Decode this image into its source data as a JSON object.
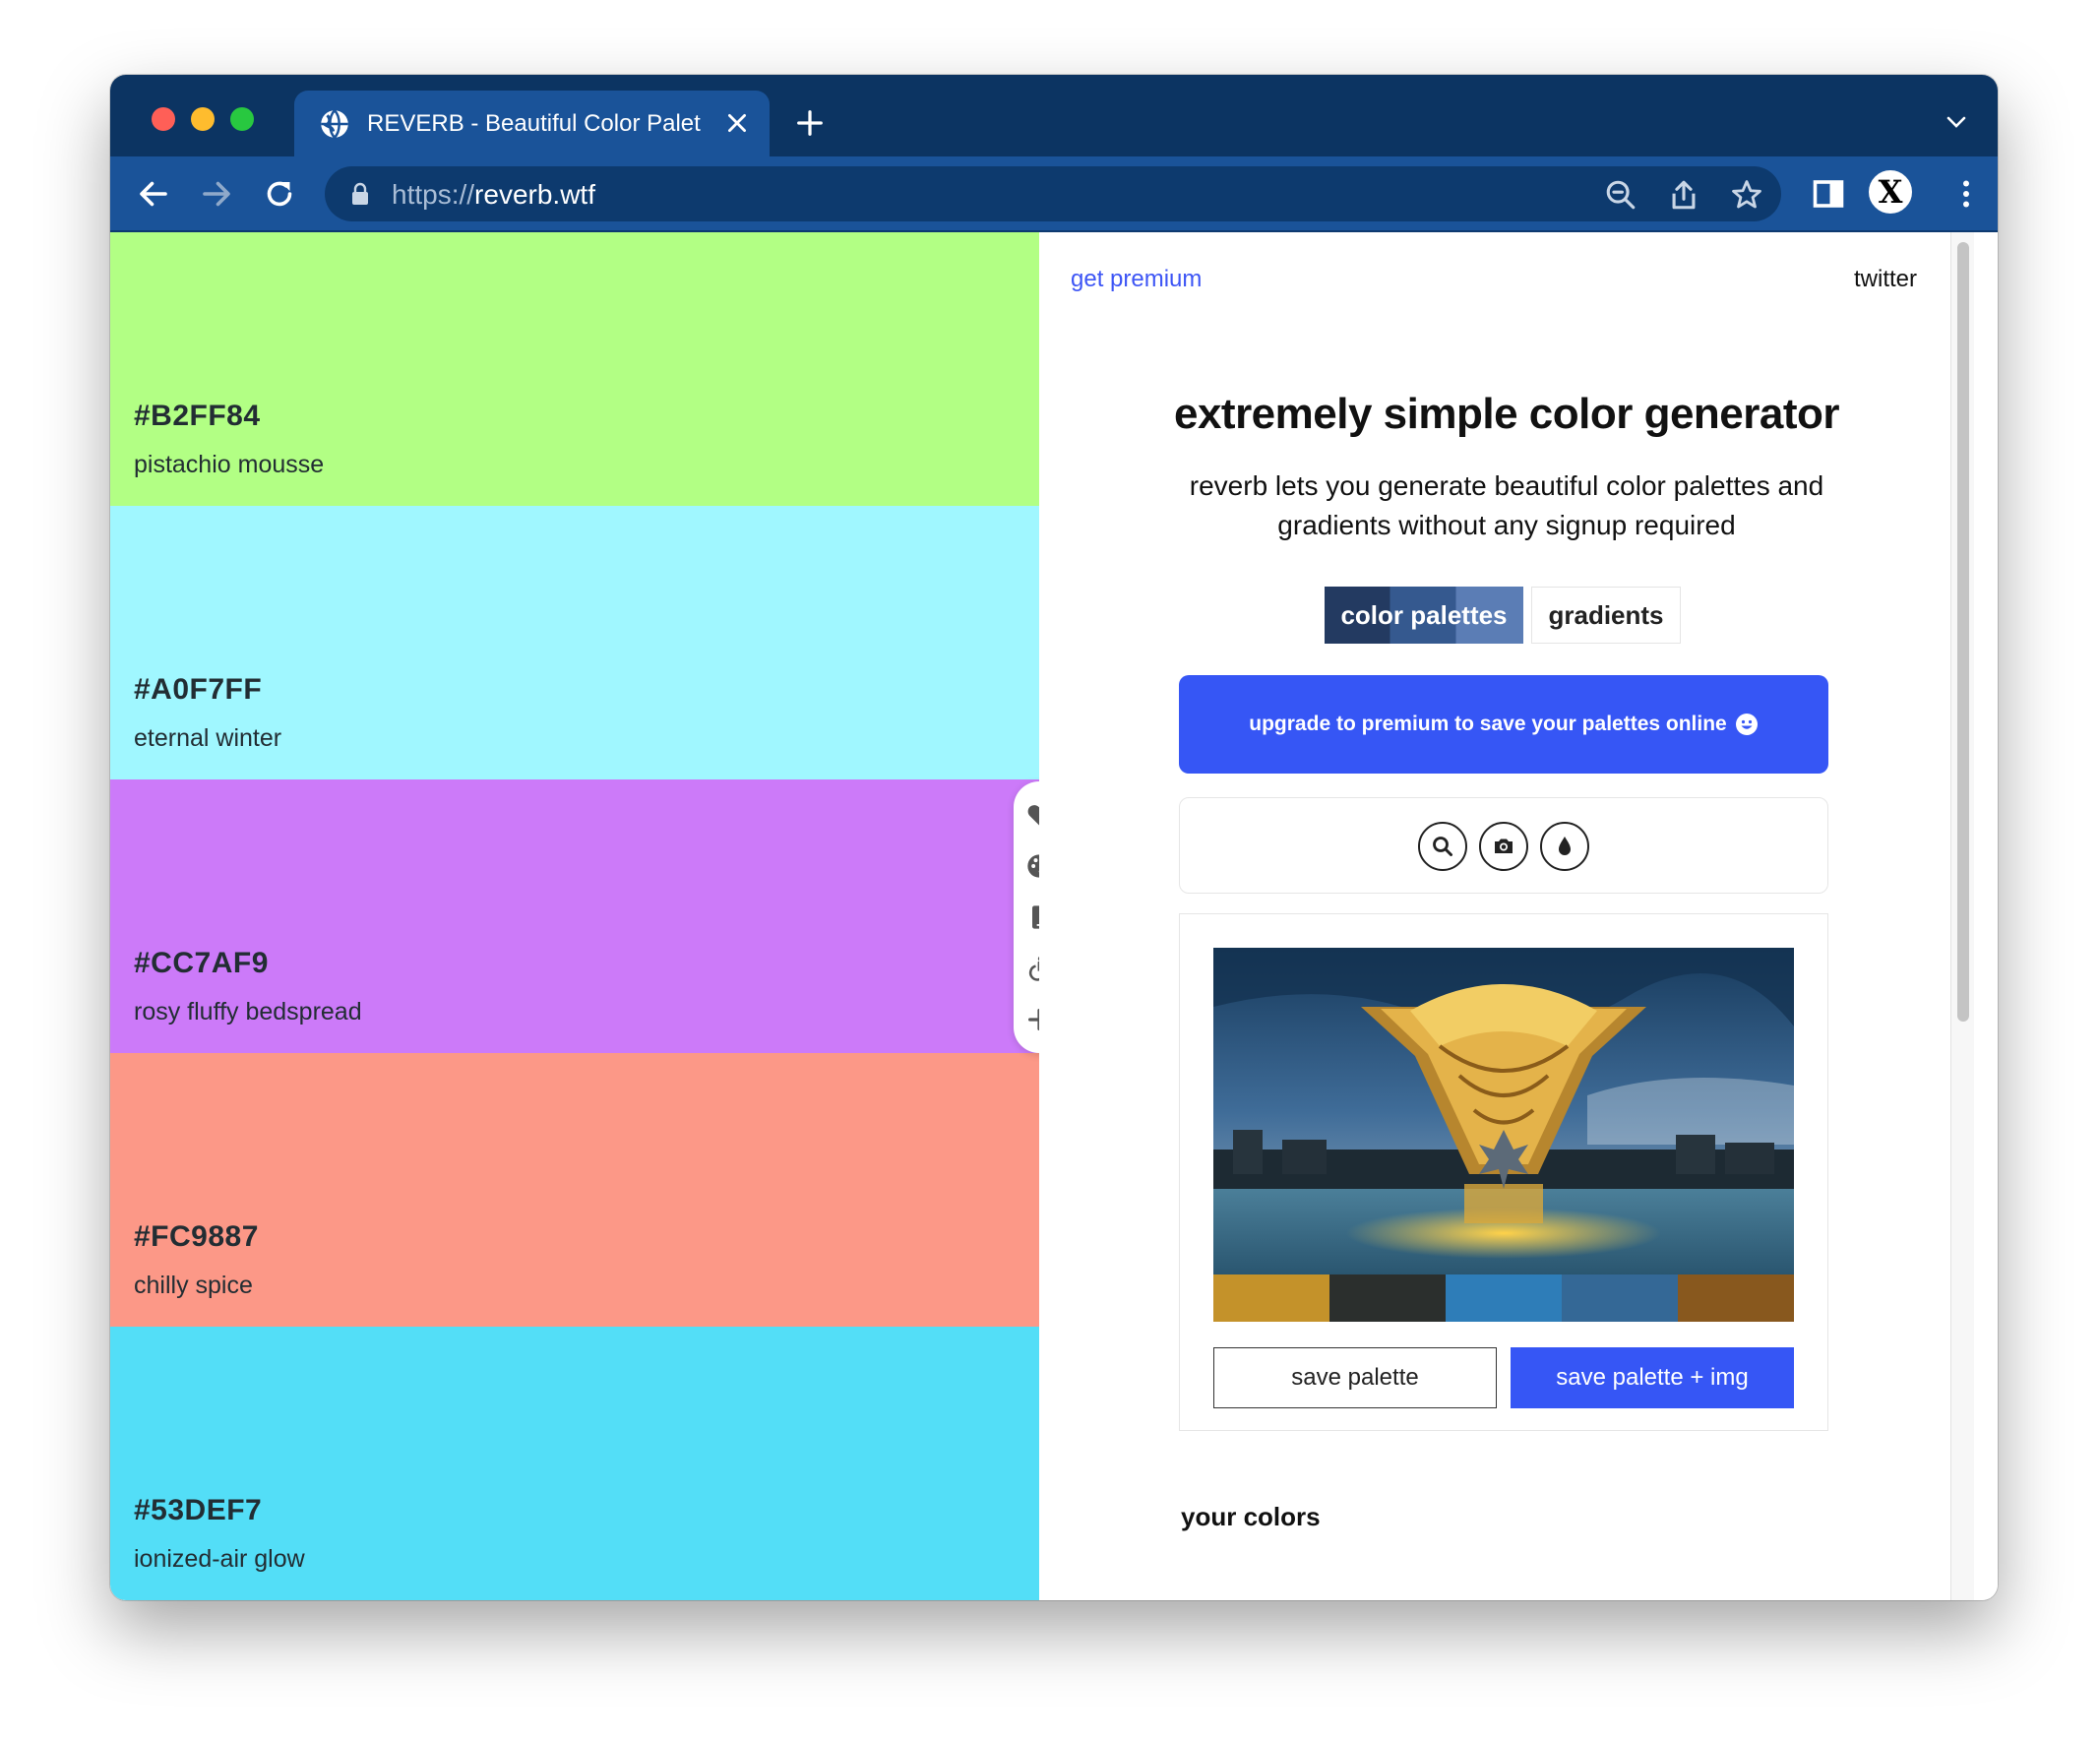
{
  "browser": {
    "tab_title": "REVERB - Beautiful Color Palet",
    "url_scheme": "https://",
    "url_host": "reverb.wtf",
    "profile_initial": "X"
  },
  "palette": [
    {
      "hex": "#B2FF84",
      "name": "pistachio mousse",
      "color": "#B2FF84"
    },
    {
      "hex": "#A0F7FF",
      "name": "eternal winter",
      "color": "#A0F7FF"
    },
    {
      "hex": "#CC7AF9",
      "name": "rosy fluffy bedspread",
      "color": "#CC7AF9"
    },
    {
      "hex": "#FC9887",
      "name": "chilly spice",
      "color": "#FC9887"
    },
    {
      "hex": "#53DEF7",
      "name": "ionized-air glow",
      "color": "#53DEF7"
    }
  ],
  "sidebar_icons": [
    "heart-icon",
    "palette-icon",
    "mobile-icon",
    "accessibility-icon",
    "plus-icon"
  ],
  "panel": {
    "get_premium": "get premium",
    "twitter": "twitter",
    "heading": "extremely simple color generator",
    "subtitle": "reverb lets you generate beautiful color palettes and gradients without any signup required",
    "tab_palettes": "color palettes",
    "tab_gradients": "gradients",
    "upgrade_label": "upgrade to premium to save your palettes online",
    "tool_icons": [
      "search-icon",
      "camera-icon",
      "droplet-icon"
    ],
    "extracted_colors": [
      "#C4922A",
      "#2B2F2D",
      "#2E7DB8",
      "#346896",
      "#88581E"
    ],
    "save_palette": "save palette",
    "save_palette_img": "save palette + img",
    "your_colors": "your colors"
  },
  "colors": {
    "titlebar": "#0c3462",
    "toolbar": "#1a5399",
    "accent": "#3656f5"
  }
}
